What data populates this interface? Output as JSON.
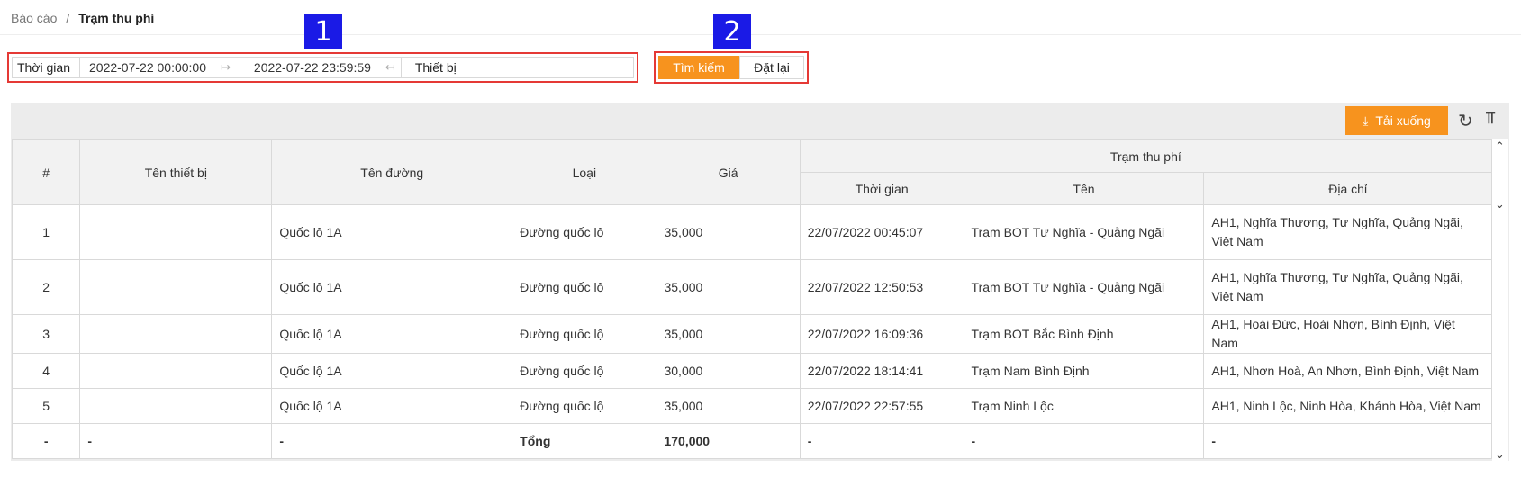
{
  "breadcrumb": {
    "parent": "Báo cáo",
    "separator": "/",
    "current": "Trạm thu phí"
  },
  "markers": {
    "m1": "1",
    "m2": "2"
  },
  "filter": {
    "time_label": "Thời gian",
    "start": "2022-07-22 00:00:00",
    "end": "2022-07-22 23:59:59",
    "device_label": "Thiết bị",
    "device_value": ""
  },
  "buttons": {
    "search": "Tìm kiếm",
    "reset": "Đặt lại",
    "download": "Tải xuống"
  },
  "icons": {
    "download": "download-icon",
    "refresh": "refresh-icon",
    "columns": "column-height-icon"
  },
  "colors": {
    "accent": "#f7931e",
    "highlight": "#e53935",
    "marker": "#1a1ae6"
  },
  "table": {
    "headers": {
      "index": "#",
      "device": "Tên thiết bị",
      "road": "Tên đường",
      "type": "Loại",
      "price": "Giá",
      "station_group": "Trạm thu phí",
      "time": "Thời gian",
      "name": "Tên",
      "address": "Địa chỉ"
    },
    "rows": [
      {
        "index": "1",
        "device": "",
        "road": "Quốc lộ 1A",
        "type": "Đường quốc lộ",
        "price": "35,000",
        "time": "22/07/2022 00:45:07",
        "name": "Trạm BOT Tư Nghĩa - Quảng Ngãi",
        "address": "AH1, Nghĩa Thương, Tư Nghĩa, Quảng Ngãi, Việt Nam"
      },
      {
        "index": "2",
        "device": "",
        "road": "Quốc lộ 1A",
        "type": "Đường quốc lộ",
        "price": "35,000",
        "time": "22/07/2022 12:50:53",
        "name": "Trạm BOT Tư Nghĩa - Quảng Ngãi",
        "address": "AH1, Nghĩa Thương, Tư Nghĩa, Quảng Ngãi, Việt Nam"
      },
      {
        "index": "3",
        "device": "",
        "road": "Quốc lộ 1A",
        "type": "Đường quốc lộ",
        "price": "35,000",
        "time": "22/07/2022 16:09:36",
        "name": "Trạm BOT Bắc Bình Định",
        "address": "AH1, Hoài Đức, Hoài Nhơn, Bình Định, Việt Nam"
      },
      {
        "index": "4",
        "device": "",
        "road": "Quốc lộ 1A",
        "type": "Đường quốc lộ",
        "price": "30,000",
        "time": "22/07/2022 18:14:41",
        "name": "Trạm Nam Bình Định",
        "address": "AH1, Nhơn Hoà, An Nhơn, Bình Định, Việt Nam"
      },
      {
        "index": "5",
        "device": "",
        "road": "Quốc lộ 1A",
        "type": "Đường quốc lộ",
        "price": "35,000",
        "time": "22/07/2022 22:57:55",
        "name": "Trạm Ninh Lộc",
        "address": "AH1, Ninh Lộc, Ninh Hòa, Khánh Hòa, Việt Nam"
      }
    ],
    "total": {
      "index": "-",
      "device": "-",
      "road": "-",
      "type": "Tổng",
      "price": "170,000",
      "time": "-",
      "name": "-",
      "address": "-"
    }
  }
}
